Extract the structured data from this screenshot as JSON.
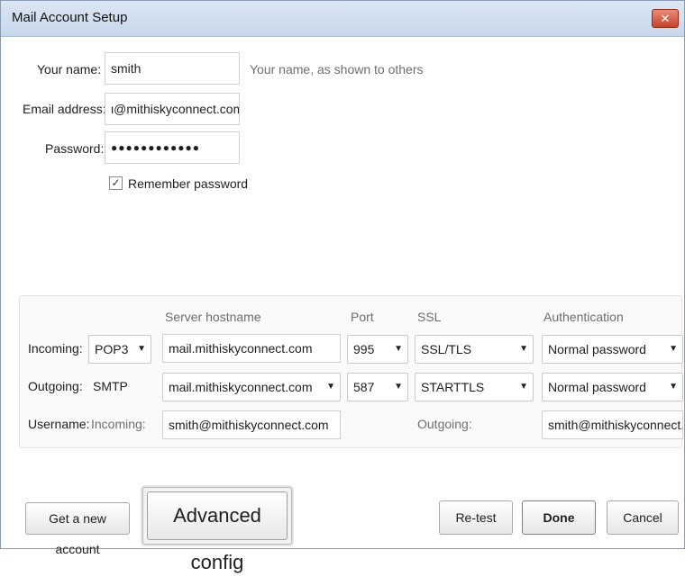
{
  "window": {
    "title": "Mail Account Setup"
  },
  "form": {
    "name_label": "Your name:",
    "name_value": "smith",
    "name_hint": "Your name, as shown to others",
    "email_label": "Email address:",
    "email_value": "ι@mithiskyconnect.com",
    "password_label": "Password:",
    "password_value": "●●●●●●●●●●●●",
    "remember_label": "Remember password",
    "remember_checked": true
  },
  "server": {
    "headers": {
      "hostname": "Server hostname",
      "port": "Port",
      "ssl": "SSL",
      "auth": "Authentication"
    },
    "incoming": {
      "label": "Incoming:",
      "protocol": "POP3",
      "hostname": "mail.mithiskyconnect.com",
      "port": "995",
      "ssl": "SSL/TLS",
      "auth": "Normal password"
    },
    "outgoing": {
      "label": "Outgoing:",
      "protocol": "SMTP",
      "hostname": "mail.mithiskyconnect.com",
      "port": "587",
      "ssl": "STARTTLS",
      "auth": "Normal password"
    },
    "username": {
      "label": "Username:",
      "incoming_label": "Incoming:",
      "incoming_value": "smith@mithiskyconnect.com",
      "outgoing_label": "Outgoing:",
      "outgoing_value": "smith@mithiskyconnect.c"
    }
  },
  "buttons": {
    "new_account": "Get a new account",
    "advanced": "Advanced config",
    "retest": "Re-test",
    "done": "Done",
    "cancel": "Cancel"
  },
  "icons": {
    "close": "close-icon",
    "dropdown": "chevron-down-icon",
    "checkmark": "checkmark-icon"
  }
}
